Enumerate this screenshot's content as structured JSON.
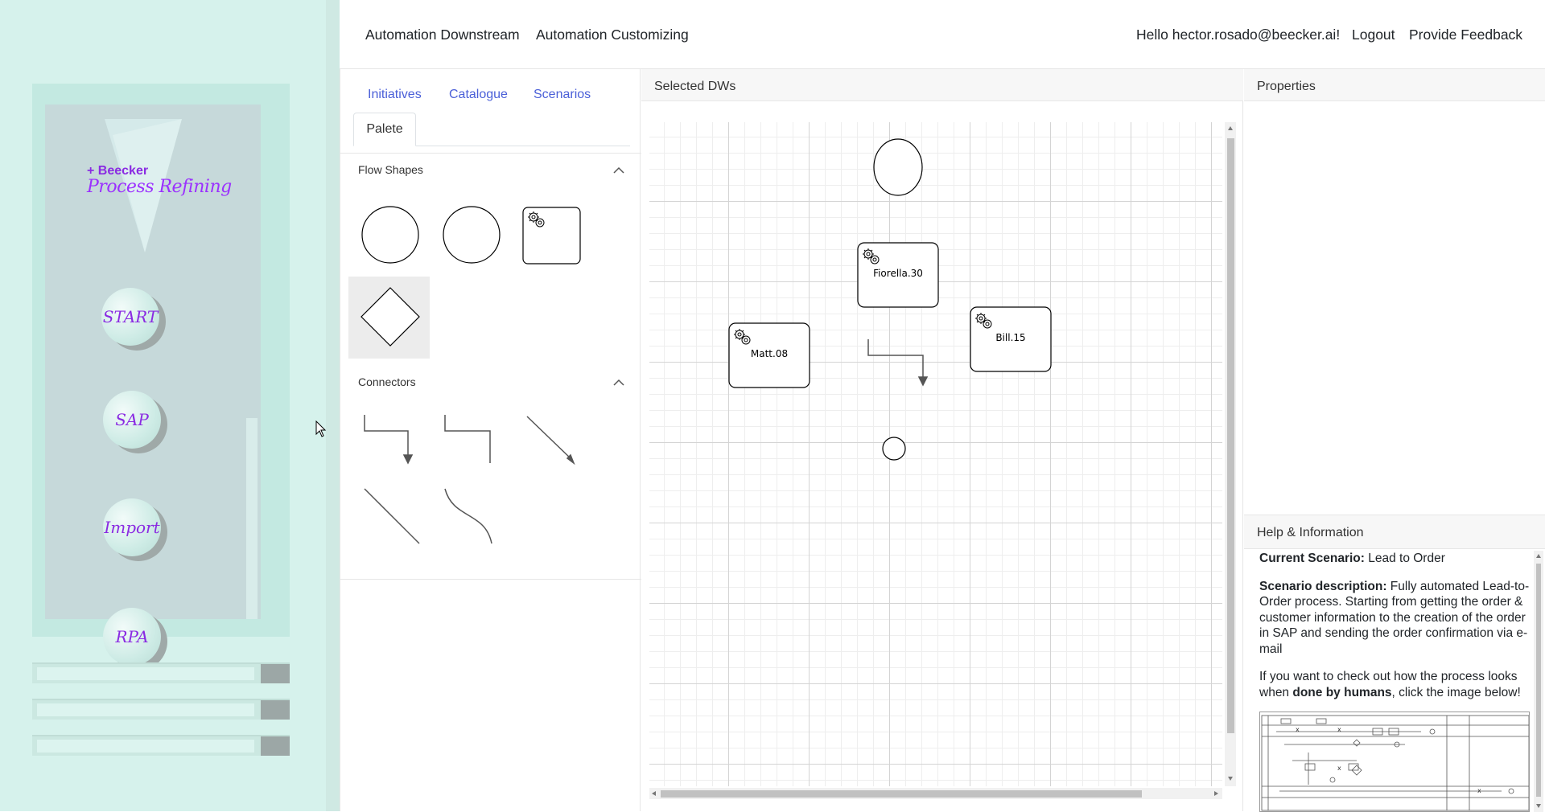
{
  "sidebar": {
    "logo_small": "+ Beecker",
    "logo_big": "Process Refining",
    "buttons": [
      {
        "label": "START"
      },
      {
        "label": "SAP"
      },
      {
        "label": "Import"
      },
      {
        "label": "RPA"
      }
    ]
  },
  "topnav": {
    "left_links": [
      "Automation Downstream",
      "Automation Customizing"
    ],
    "greeting": "Hello hector.rosado@beecker.ai!",
    "logout": "Logout",
    "feedback": "Provide Feedback"
  },
  "palette": {
    "tabs": [
      "Initiatives",
      "Catalogue",
      "Scenarios"
    ],
    "active_tab": "Palete",
    "sections": {
      "flow_shapes": "Flow Shapes",
      "connectors": "Connectors"
    },
    "flow_shapes": [
      "start-circle",
      "end-circle",
      "service-task",
      "gateway-diamond"
    ],
    "connectors": [
      "elbow-arrow",
      "elbow-line",
      "straight-arrow",
      "straight-line",
      "bezier-curve"
    ]
  },
  "canvas": {
    "title": "Selected DWs",
    "nodes": [
      {
        "type": "start-circle",
        "label": ""
      },
      {
        "type": "service-task",
        "label": "Fiorella.30"
      },
      {
        "type": "service-task",
        "label": "Matt.08"
      },
      {
        "type": "service-task",
        "label": "Bill.15"
      },
      {
        "type": "elbow-arrow",
        "label": ""
      },
      {
        "type": "end-circle",
        "label": ""
      }
    ]
  },
  "properties": {
    "title": "Properties"
  },
  "help": {
    "title": "Help & Information",
    "scenario_label": "Current Scenario:",
    "scenario_value": "Lead to Order",
    "description_label": "Scenario description:",
    "description_value": "Fully automated Lead-to-Order process. Starting from getting the order & customer information to the creation of the order in SAP and sending the order confirmation via e-mail",
    "human_text_1": "If you want to check out how the process looks when ",
    "human_bold": "done by humans",
    "human_text_2": ", click the image below!"
  },
  "colors": {
    "sidebar_bg": "#d6f2ec",
    "logo_purple": "#8a2be2",
    "link_blue": "#4a5fd8"
  }
}
